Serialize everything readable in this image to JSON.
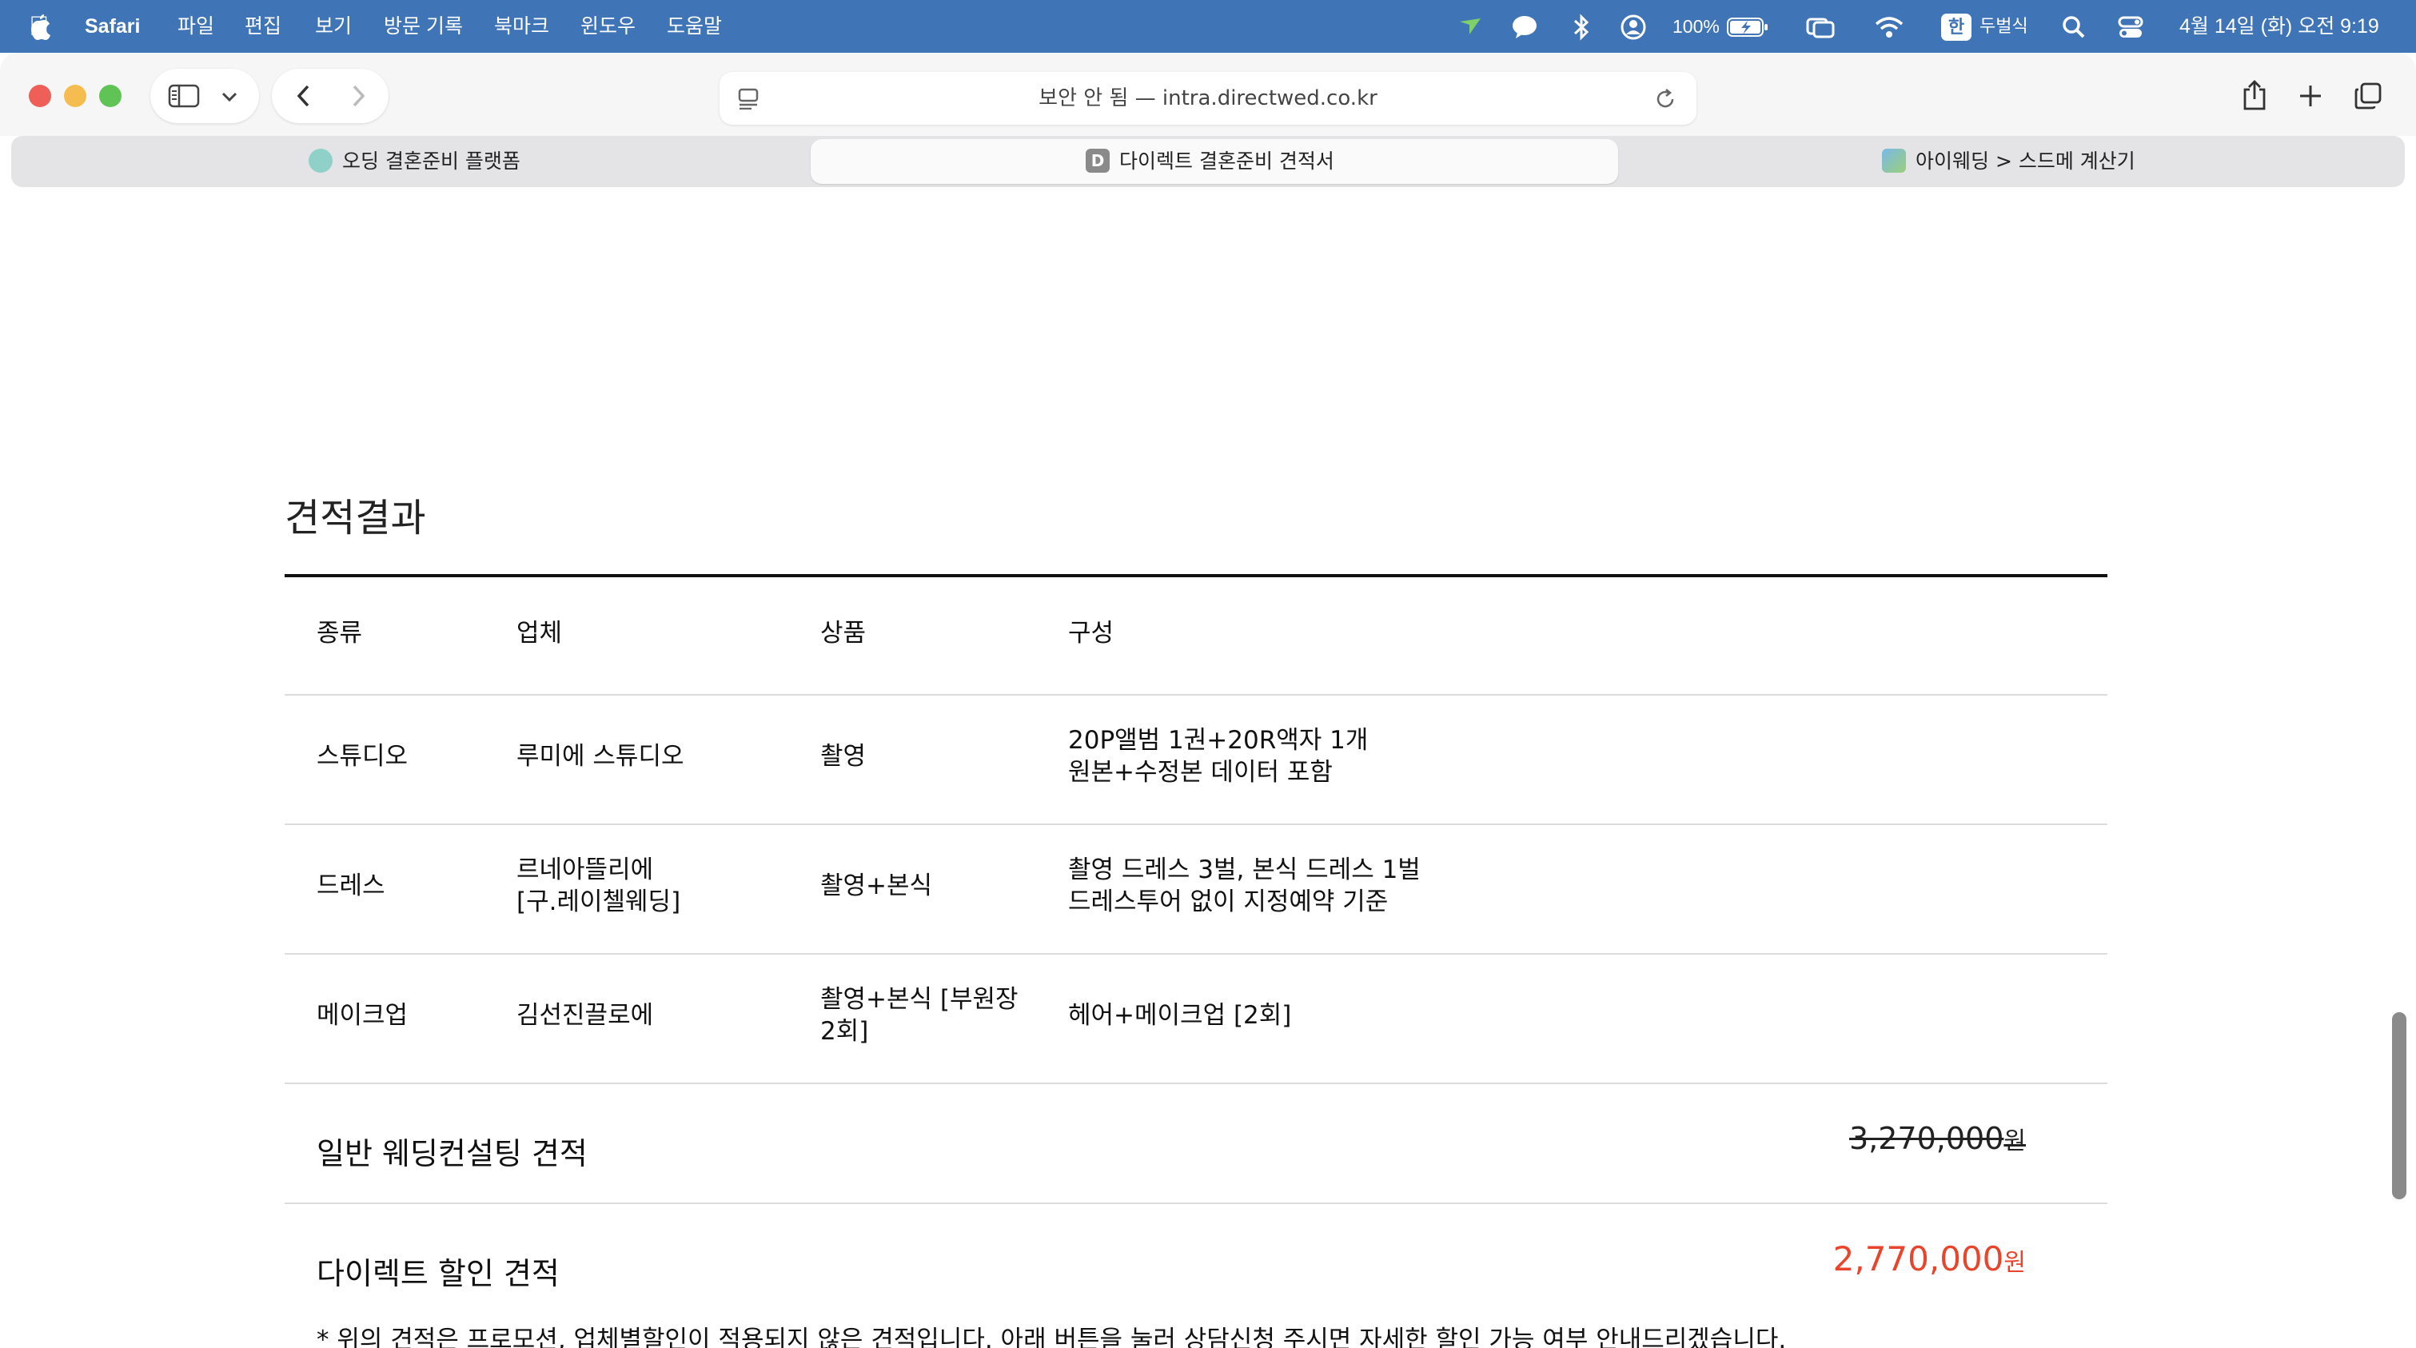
{
  "menubar": {
    "app_name": "Safari",
    "menus": [
      "파일",
      "편집",
      "보기",
      "방문 기록",
      "북마크",
      "윈도우",
      "도움말"
    ],
    "battery": "100%",
    "ime_badge": "한",
    "ime_label": "두벌식",
    "clock": "4월 14일 (화) 오전 9:19"
  },
  "toolbar": {
    "address_text": "보안 안 됨 — intra.directwed.co.kr"
  },
  "tabs": [
    {
      "label": "오딩 결혼준비 플랫폼",
      "active": false
    },
    {
      "label": "다이렉트 결혼준비 견적서",
      "active": true,
      "favicon_letter": "D"
    },
    {
      "label": "아이웨딩 > 스드메 계산기",
      "active": false
    }
  ],
  "page": {
    "title": "견적결과",
    "table": {
      "headers": [
        "종류",
        "업체",
        "상품",
        "구성"
      ],
      "rows": [
        {
          "type": "스튜디오",
          "vendor": "루미에 스튜디오",
          "product": "촬영",
          "composition": [
            "20P앨범 1권+20R액자 1개",
            "원본+수정본 데이터 포함"
          ]
        },
        {
          "type": "드레스",
          "vendor": [
            "르네아뜰리에",
            "[구.레이첼웨딩]"
          ],
          "product": "촬영+본식",
          "composition": [
            "촬영 드레스 3벌, 본식 드레스 1벌",
            "드레스투어 없이 지정예약 기준"
          ]
        },
        {
          "type": "메이크업",
          "vendor": "김선진끌로에",
          "product": [
            "촬영+본식 [부원장",
            "2회]"
          ],
          "composition": "헤어+메이크업 [2회]"
        }
      ]
    },
    "general_estimate": {
      "label": "일반 웨딩컨설팅 견적",
      "amount": "3,270,000",
      "unit": "원"
    },
    "direct_estimate": {
      "label": "다이렉트 할인 견적",
      "amount": "2,770,000",
      "unit": "원"
    },
    "note": "* 위의 견적은 프로모션, 업체별할인이 적용되지 않은 견적입니다. 아래 버튼을 눌러 상담신청 주시면 자세한 할인 가능 여부 안내드리겠습니다."
  },
  "colors": {
    "menubar_bg": "#3f74b6",
    "discount_price": "#e8452c",
    "close": "#ee5f57",
    "minimize": "#f5bd4f",
    "zoom": "#5fc455"
  }
}
